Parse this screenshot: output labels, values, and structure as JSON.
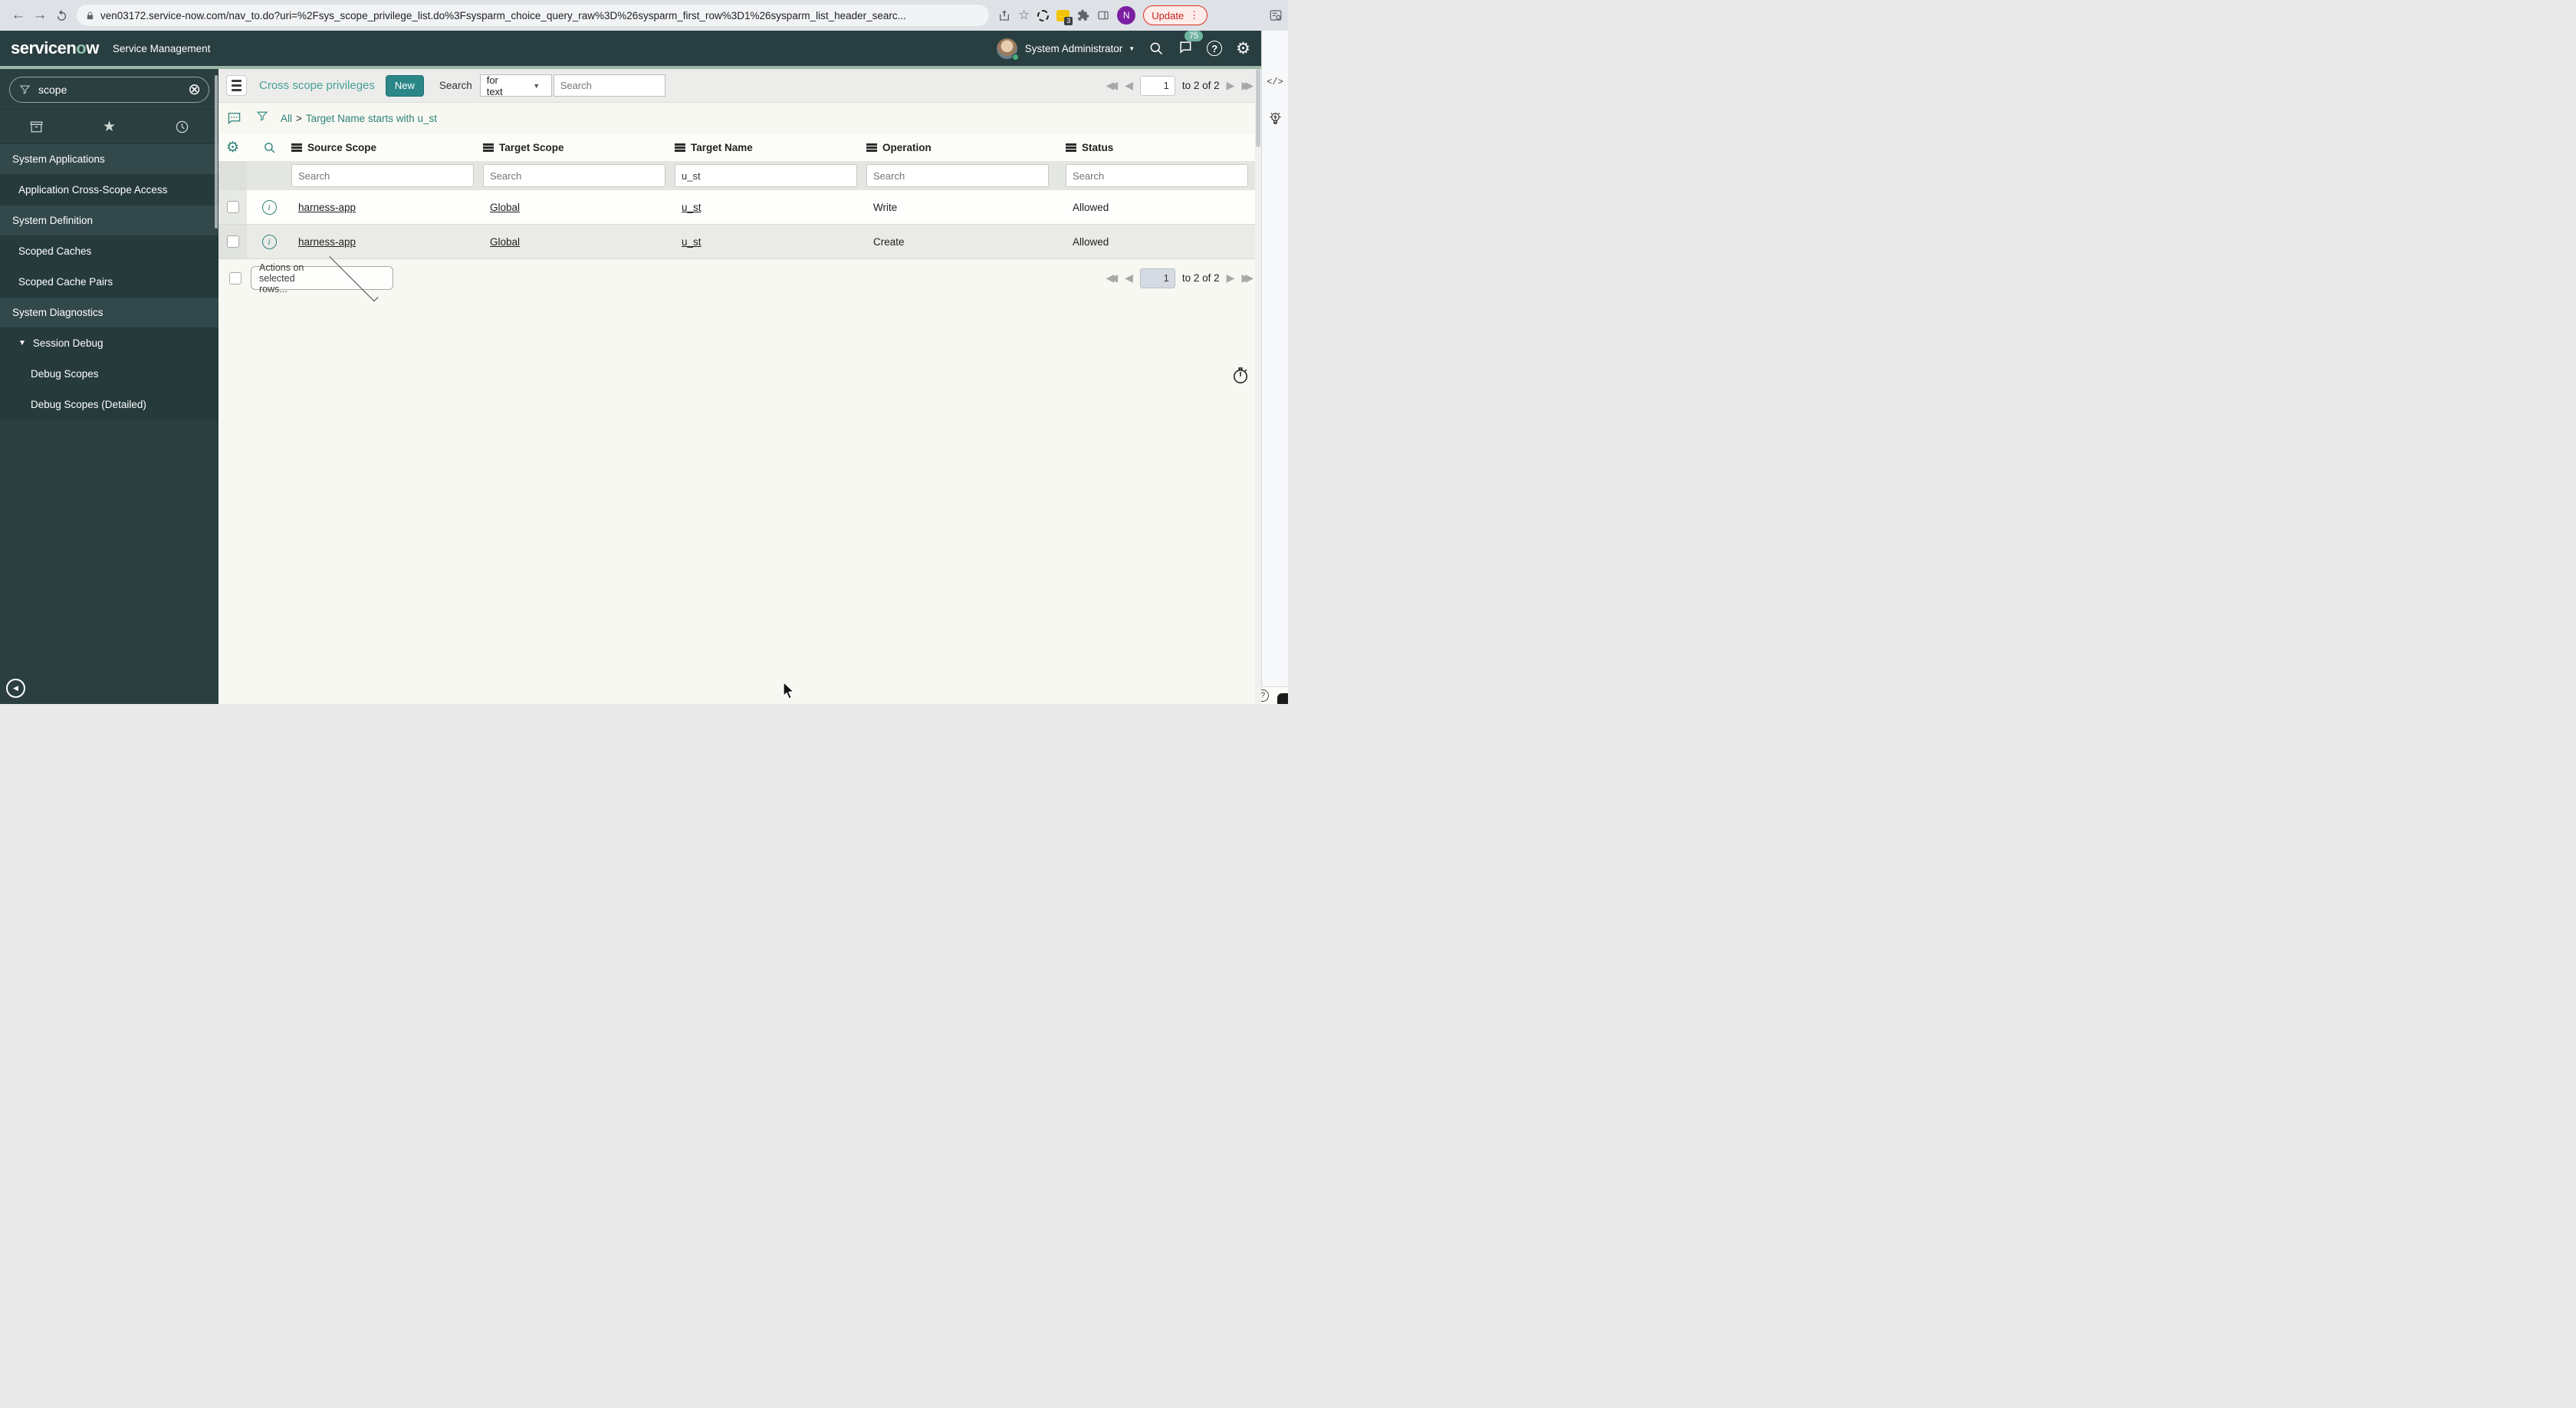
{
  "browser": {
    "url": "ven03172.service-now.com/nav_to.do?uri=%2Fsys_scope_privilege_list.do%3Fsysparm_choice_query_raw%3D%26sysparm_first_row%3D1%26sysparm_list_header_searc...",
    "update_label": "Update",
    "extension_badge": "3",
    "profile_letter": "N"
  },
  "app_header": {
    "logo_part1": "servicen",
    "logo_part2": "o",
    "logo_part3": "w",
    "product": "Service Management",
    "user": "System Administrator",
    "notification_count": "75"
  },
  "sidebar": {
    "filter_value": "scope",
    "items": [
      {
        "label": "System Applications",
        "type": "header"
      },
      {
        "label": "Application Cross-Scope Access",
        "type": "item"
      },
      {
        "label": "System Definition",
        "type": "header"
      },
      {
        "label": "Scoped Caches",
        "type": "item"
      },
      {
        "label": "Scoped Cache Pairs",
        "type": "item"
      },
      {
        "label": "System Diagnostics",
        "type": "header"
      },
      {
        "label": "Session Debug",
        "type": "item-expanded"
      },
      {
        "label": "Debug Scopes",
        "type": "subitem"
      },
      {
        "label": "Debug Scopes (Detailed)",
        "type": "subitem"
      }
    ]
  },
  "list": {
    "title": "Cross scope privileges",
    "new_button": "New",
    "search_label": "Search",
    "search_type": "for text",
    "search_placeholder": "Search",
    "breadcrumb": {
      "all": "All",
      "separator": ">",
      "condition": "Target Name starts with u_st"
    },
    "columns": [
      "Source Scope",
      "Target Scope",
      "Target Name",
      "Operation",
      "Status"
    ],
    "filter_row": {
      "source_scope_placeholder": "Search",
      "target_scope_placeholder": "Search",
      "target_name_value": "u_st",
      "operation_placeholder": "Search",
      "status_placeholder": "Search"
    },
    "rows": [
      {
        "source_scope": "harness-app",
        "target_scope": "Global",
        "target_name": "u_st",
        "operation": "Write",
        "status": "Allowed"
      },
      {
        "source_scope": "harness-app",
        "target_scope": "Global",
        "target_name": "u_st",
        "operation": "Create",
        "status": "Allowed"
      }
    ],
    "actions_dropdown": "Actions on selected rows...",
    "pagination": {
      "page": "1",
      "range_label": "to 2 of 2"
    }
  },
  "icons": {
    "back": "←",
    "forward": "→",
    "star_outline": "☆",
    "kebab": "⋮",
    "gear": "⚙",
    "clear_circle_x": "⊗",
    "star_filled": "★",
    "caret_down": "▼",
    "first": "◀◀",
    "prev": "◀",
    "next": "▶",
    "last": "▶▶",
    "code": "</>",
    "ellipsis": "..."
  },
  "colors": {
    "accent": "#2f837b",
    "header_bg": "#293e40",
    "new_button_bg": "#2b8787",
    "badge_bg": "#6fb3a0",
    "update_red": "#c5221f"
  }
}
